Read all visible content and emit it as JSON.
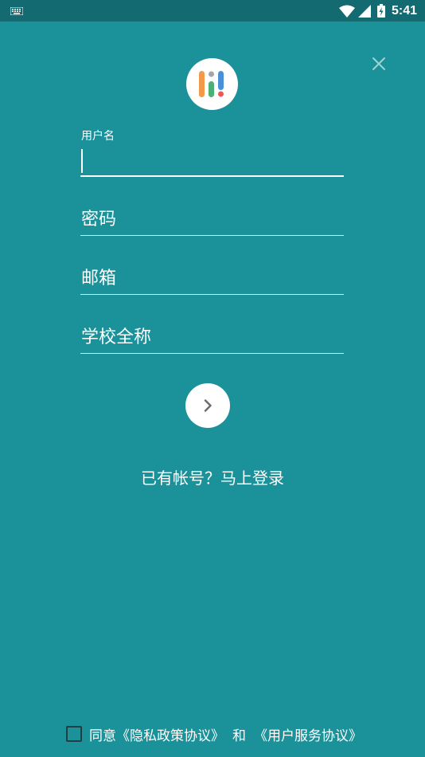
{
  "status_bar": {
    "time": "5:41",
    "icons": [
      "keyboard-icon",
      "wifi-icon",
      "signal-icon",
      "battery-charging-icon"
    ]
  },
  "colors": {
    "background": "#1b9199",
    "status_bar": "#136a70",
    "logo_orange": "#f2994a",
    "logo_green": "#4caf73",
    "logo_blue": "#4a90d9",
    "logo_red": "#eb5757"
  },
  "form": {
    "username": {
      "label": "用户名",
      "value": ""
    },
    "password": {
      "placeholder": "密码",
      "value": ""
    },
    "email": {
      "placeholder": "邮箱",
      "value": ""
    },
    "school": {
      "placeholder": "学校全称",
      "value": ""
    }
  },
  "actions": {
    "next_icon": "chevron-right-icon",
    "close_icon": "close-icon",
    "login_link": "已有帐号？马上登录"
  },
  "agreement": {
    "checked": false,
    "prefix": "同意",
    "privacy": "《隐私政策协议》",
    "and": "和",
    "terms": "《用户服务协议》"
  }
}
